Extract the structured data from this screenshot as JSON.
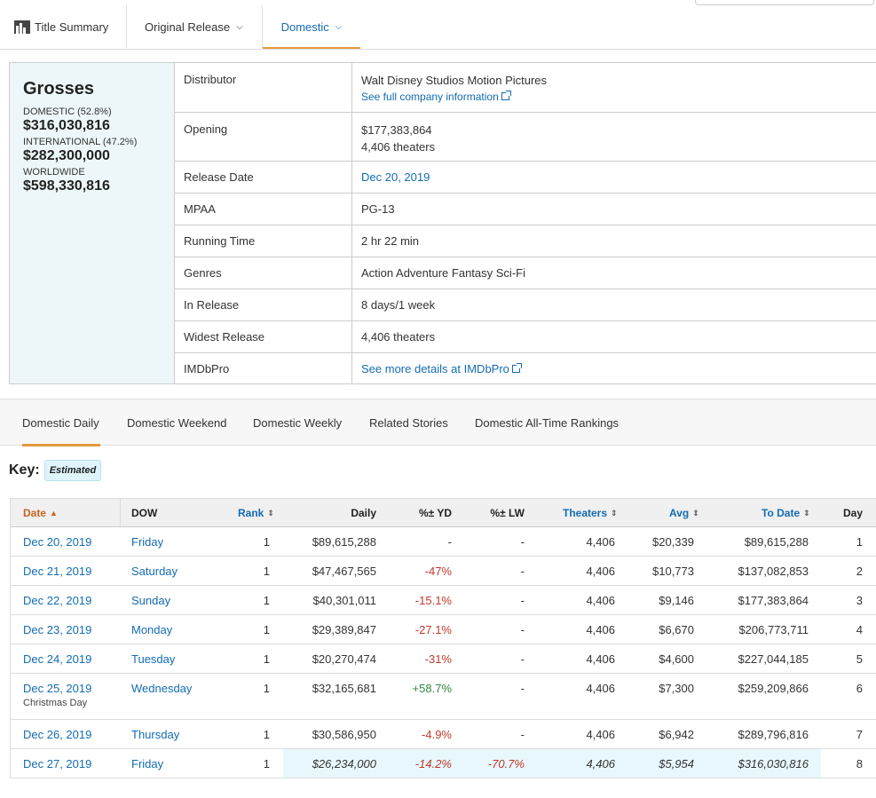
{
  "nav": {
    "title_summary": "Title Summary",
    "original_release": "Original Release",
    "domestic": "Domestic"
  },
  "grosses": {
    "heading": "Grosses",
    "domestic_label": "DOMESTIC (52.8%)",
    "domestic_value": "$316,030,816",
    "international_label": "INTERNATIONAL (47.2%)",
    "international_value": "$282,300,000",
    "worldwide_label": "WORLDWIDE",
    "worldwide_value": "$598,330,816"
  },
  "info": {
    "distributor_label": "Distributor",
    "distributor_value": "Walt Disney Studios Motion Pictures",
    "distributor_link": "See full company information",
    "opening_label": "Opening",
    "opening_value": "$177,383,864",
    "opening_theaters": "4,406 theaters",
    "release_label": "Release Date",
    "release_value": "Dec 20, 2019",
    "mpaa_label": "MPAA",
    "mpaa_value": "PG-13",
    "runtime_label": "Running Time",
    "runtime_value": "2 hr 22 min",
    "genres_label": "Genres",
    "genres_value": "Action Adventure Fantasy Sci-Fi",
    "inrelease_label": "In Release",
    "inrelease_value": "8 days/1 week",
    "widest_label": "Widest Release",
    "widest_value": "4,406 theaters",
    "imdb_label": "IMDbPro",
    "imdb_value": "See more details at IMDbPro"
  },
  "subtabs": [
    "Domestic Daily",
    "Domestic Weekend",
    "Domestic Weekly",
    "Related Stories",
    "Domestic All-Time Rankings"
  ],
  "key": {
    "label": "Key:",
    "badge": "Estimated"
  },
  "table": {
    "headers": {
      "date": "Date",
      "dow": "DOW",
      "rank": "Rank",
      "daily": "Daily",
      "pct_yd": "%± YD",
      "pct_lw": "%± LW",
      "theaters": "Theaters",
      "avg": "Avg",
      "to_date": "To Date",
      "day": "Day"
    },
    "rows": [
      {
        "date": "Dec 20, 2019",
        "dow": "Friday",
        "rank": "1",
        "daily": "$89,615,288",
        "yd": "-",
        "lw": "-",
        "theaters": "4,406",
        "avg": "$20,339",
        "todate": "$89,615,288",
        "day": "1"
      },
      {
        "date": "Dec 21, 2019",
        "dow": "Saturday",
        "rank": "1",
        "daily": "$47,467,565",
        "yd": "-47%",
        "lw": "-",
        "theaters": "4,406",
        "avg": "$10,773",
        "todate": "$137,082,853",
        "day": "2"
      },
      {
        "date": "Dec 22, 2019",
        "dow": "Sunday",
        "rank": "1",
        "daily": "$40,301,011",
        "yd": "-15.1%",
        "lw": "-",
        "theaters": "4,406",
        "avg": "$9,146",
        "todate": "$177,383,864",
        "day": "3"
      },
      {
        "date": "Dec 23, 2019",
        "dow": "Monday",
        "rank": "1",
        "daily": "$29,389,847",
        "yd": "-27.1%",
        "lw": "-",
        "theaters": "4,406",
        "avg": "$6,670",
        "todate": "$206,773,711",
        "day": "4"
      },
      {
        "date": "Dec 24, 2019",
        "dow": "Tuesday",
        "rank": "1",
        "daily": "$20,270,474",
        "yd": "-31%",
        "lw": "-",
        "theaters": "4,406",
        "avg": "$4,600",
        "todate": "$227,044,185",
        "day": "5"
      },
      {
        "date": "Dec 25, 2019",
        "dow": "Wednesday",
        "rank": "1",
        "daily": "$32,165,681",
        "yd": "+58.7%",
        "lw": "-",
        "theaters": "4,406",
        "avg": "$7,300",
        "todate": "$259,209,866",
        "day": "6",
        "holiday": "Christmas Day"
      },
      {
        "date": "Dec 26, 2019",
        "dow": "Thursday",
        "rank": "1",
        "daily": "$30,586,950",
        "yd": "-4.9%",
        "lw": "-",
        "theaters": "4,406",
        "avg": "$6,942",
        "todate": "$289,796,816",
        "day": "7"
      },
      {
        "date": "Dec 27, 2019",
        "dow": "Friday",
        "rank": "1",
        "daily": "$26,234,000",
        "yd": "-14.2%",
        "lw": "-70.7%",
        "theaters": "4,406",
        "avg": "$5,954",
        "todate": "$316,030,816",
        "day": "8",
        "estimated": true
      }
    ]
  },
  "colors": {
    "link": "#136cb2",
    "accent": "#e59a3e",
    "negative": "#c0392b",
    "positive": "#2e8540",
    "estimated_bg": "#e8f7fb"
  }
}
